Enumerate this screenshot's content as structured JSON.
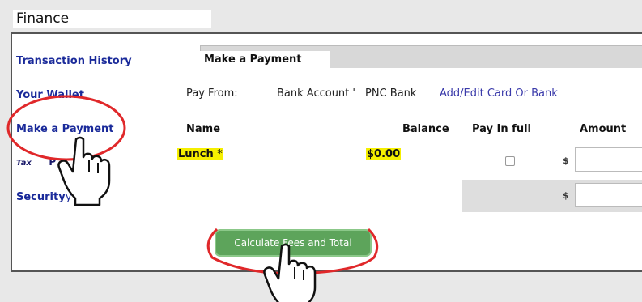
{
  "window": {
    "title": "Finance"
  },
  "sidebar": {
    "items": [
      {
        "label": "Transaction History"
      },
      {
        "label": "Your Wallet"
      },
      {
        "label": "Make a Payment"
      },
      {
        "label": "Tax",
        "label_rest": "P"
      },
      {
        "label": "Security",
        "label_rest": "y"
      }
    ]
  },
  "tabs": {
    "active_label": "Make a Payment"
  },
  "pay_from": {
    "label": "Pay From:",
    "account": "Bank Account '",
    "bank": "PNC Bank",
    "edit_link": "Add/Edit Card Or Bank"
  },
  "table": {
    "headers": {
      "name": "Name",
      "balance": "Balance",
      "pay_in_full": "Pay In full",
      "amount": "Amount"
    },
    "rows": [
      {
        "name": "Lunch",
        "required_mark": "*",
        "balance": "$0.00",
        "currency": "$"
      },
      {
        "currency": "$"
      }
    ]
  },
  "actions": {
    "calculate_label": "Calculate Fees and Total"
  },
  "colors": {
    "link": "#1a2a9a",
    "highlight": "#f5ef00",
    "button": "#5da45b",
    "annotation": "#e0282a"
  }
}
